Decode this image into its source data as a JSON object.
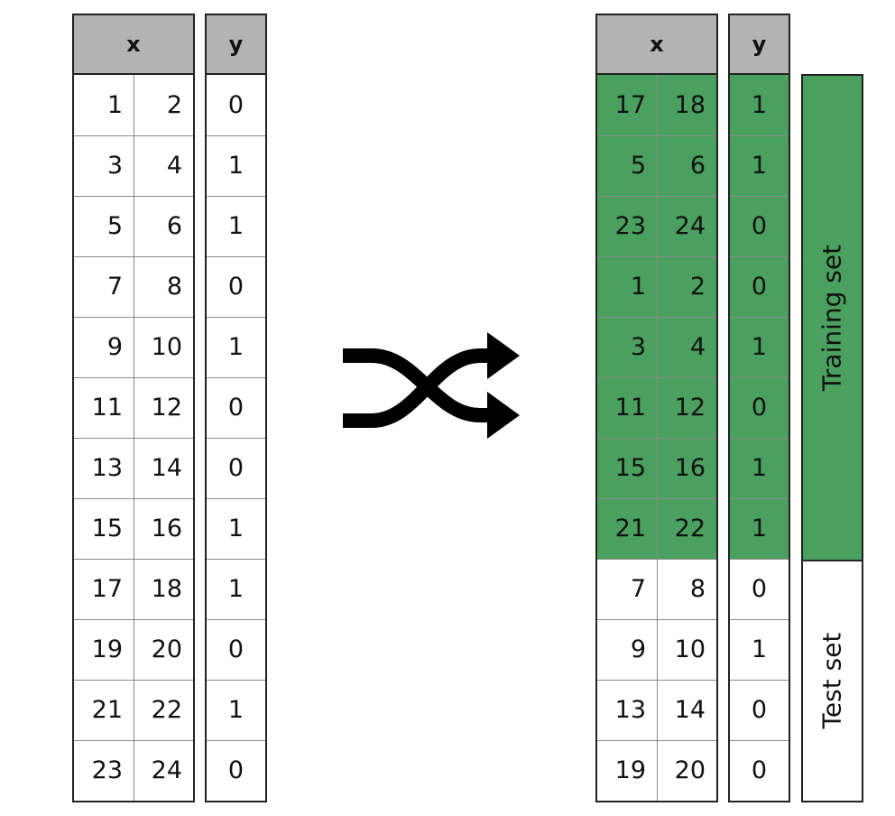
{
  "original": {
    "header_x": "x",
    "header_y": "y",
    "rows": [
      [
        "1",
        "2",
        "0"
      ],
      [
        "3",
        "4",
        "1"
      ],
      [
        "5",
        "6",
        "1"
      ],
      [
        "7",
        "8",
        "0"
      ],
      [
        "9",
        "10",
        "1"
      ],
      [
        "11",
        "12",
        "0"
      ],
      [
        "13",
        "14",
        "0"
      ],
      [
        "15",
        "16",
        "1"
      ],
      [
        "17",
        "18",
        "1"
      ],
      [
        "19",
        "20",
        "0"
      ],
      [
        "21",
        "22",
        "1"
      ],
      [
        "23",
        "24",
        "0"
      ]
    ]
  },
  "shuffled": {
    "header_x": "x",
    "header_y": "y",
    "rows": [
      [
        "17",
        "18",
        "1"
      ],
      [
        "5",
        "6",
        "1"
      ],
      [
        "23",
        "24",
        "0"
      ],
      [
        "1",
        "2",
        "0"
      ],
      [
        "3",
        "4",
        "1"
      ],
      [
        "11",
        "12",
        "0"
      ],
      [
        "15",
        "16",
        "1"
      ],
      [
        "21",
        "22",
        "1"
      ],
      [
        "7",
        "8",
        "0"
      ],
      [
        "9",
        "10",
        "1"
      ],
      [
        "13",
        "14",
        "0"
      ],
      [
        "19",
        "20",
        "0"
      ]
    ],
    "training_rows": 8
  },
  "labels": {
    "training": "Training set",
    "test": "Test set"
  },
  "icons": {
    "shuffle": "shuffle-icon"
  },
  "colors": {
    "training": "#4aa05e",
    "header": "#b3b3b3"
  }
}
